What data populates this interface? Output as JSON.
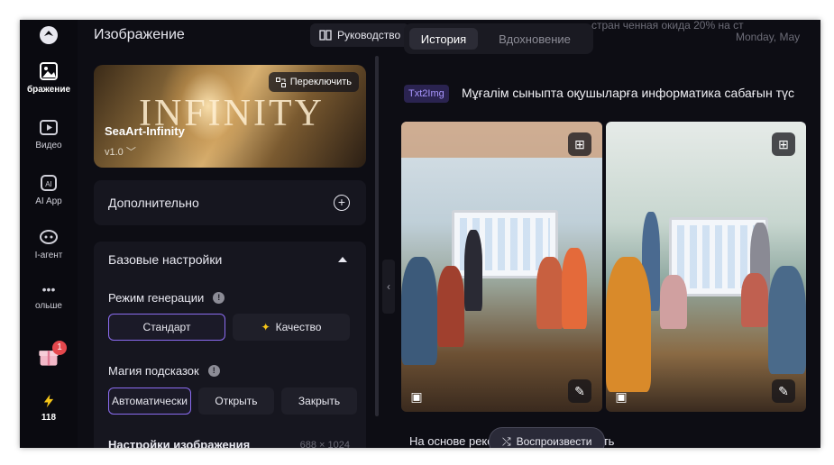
{
  "sidebar": {
    "items": [
      {
        "label": "",
        "icon": "logo-icon"
      },
      {
        "label": "бражение",
        "icon": "image-icon",
        "active": true
      },
      {
        "label": "Видео",
        "icon": "video-icon"
      },
      {
        "label": "AI App",
        "icon": "ai-app-icon"
      },
      {
        "label": "I-агент",
        "icon": "agent-icon"
      },
      {
        "label": "ольше",
        "icon": "more-icon"
      },
      {
        "label": "",
        "icon": "gift-icon",
        "badge": "1"
      },
      {
        "label": "118",
        "icon": "lightning-icon"
      }
    ]
  },
  "panel": {
    "title": "Изображение",
    "guide_label": "Руководство",
    "model": {
      "name": "SeaArt-Infinity",
      "version": "v1.0",
      "watermark": "INFINITY",
      "switch_label": "Переключить"
    },
    "advanced_label": "Дополнительно",
    "basic_label": "Базовые настройки",
    "mode_label": "Режим генерации",
    "mode_options": [
      "Стандарт",
      "Качество"
    ],
    "mode_selected": "Стандарт",
    "magic_label": "Магия подсказок",
    "magic_options": [
      "Автоматически",
      "Открыть",
      "Закрыть"
    ],
    "magic_selected": "Автоматически",
    "image_settings_label": "Настройки изображения",
    "image_size": "688 × 1024"
  },
  "main": {
    "tabs": [
      {
        "label": "История",
        "active": true
      },
      {
        "label": "Вдохновение",
        "active": false
      }
    ],
    "faded_line1": "стран ченная окида 20% на ст",
    "faded_line2": "Monday, May",
    "tag": "Txt2Img",
    "prompt": "Мұғалім сыныпта оқушыларға информатика сабағын түс",
    "bottom_text": "На основе   рекомендуем попробовать",
    "reproduce_label": "Воспроизвести"
  },
  "colors": {
    "accent": "#8b6cf0",
    "background": "#0d0d14",
    "badge": "#e5484d"
  }
}
